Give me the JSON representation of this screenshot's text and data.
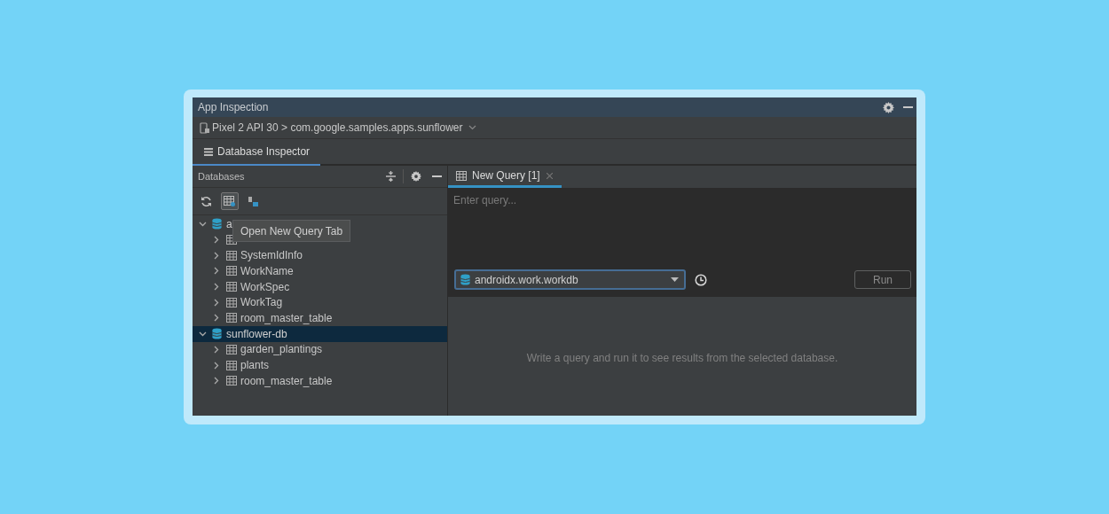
{
  "window": {
    "title": "App Inspection"
  },
  "device_bar": {
    "label": "Pixel 2 API 30 > com.google.samples.apps.sunflower"
  },
  "tabs": [
    {
      "label": "Database Inspector",
      "selected": true
    }
  ],
  "databases_panel": {
    "title": "Databases",
    "tree": [
      {
        "label": "a",
        "selected": false,
        "expanded": true,
        "children": [
          {
            "kind": "table"
          },
          {
            "label": "SystemIdInfo",
            "kind": "table"
          },
          {
            "label": "WorkName",
            "kind": "table"
          },
          {
            "label": "WorkSpec",
            "kind": "table"
          },
          {
            "label": "WorkTag",
            "kind": "table"
          },
          {
            "label": "room_master_table",
            "kind": "table"
          }
        ]
      },
      {
        "label": "sunflower-db",
        "selected": true,
        "expanded": true,
        "children": [
          {
            "label": "garden_plantings",
            "kind": "table"
          },
          {
            "label": "plants",
            "kind": "table"
          },
          {
            "label": "room_master_table",
            "kind": "table"
          }
        ]
      }
    ],
    "tooltip": "Open New Query Tab"
  },
  "query_tabs": [
    {
      "label": "New Query [1]",
      "selected": true
    }
  ],
  "query_editor": {
    "placeholder": "Enter query..."
  },
  "database_select": {
    "value": "androidx.work.workdb"
  },
  "run_button": {
    "label": "Run",
    "disabled": true
  },
  "results_message": "Write a query and run it to see results from the selected database."
}
